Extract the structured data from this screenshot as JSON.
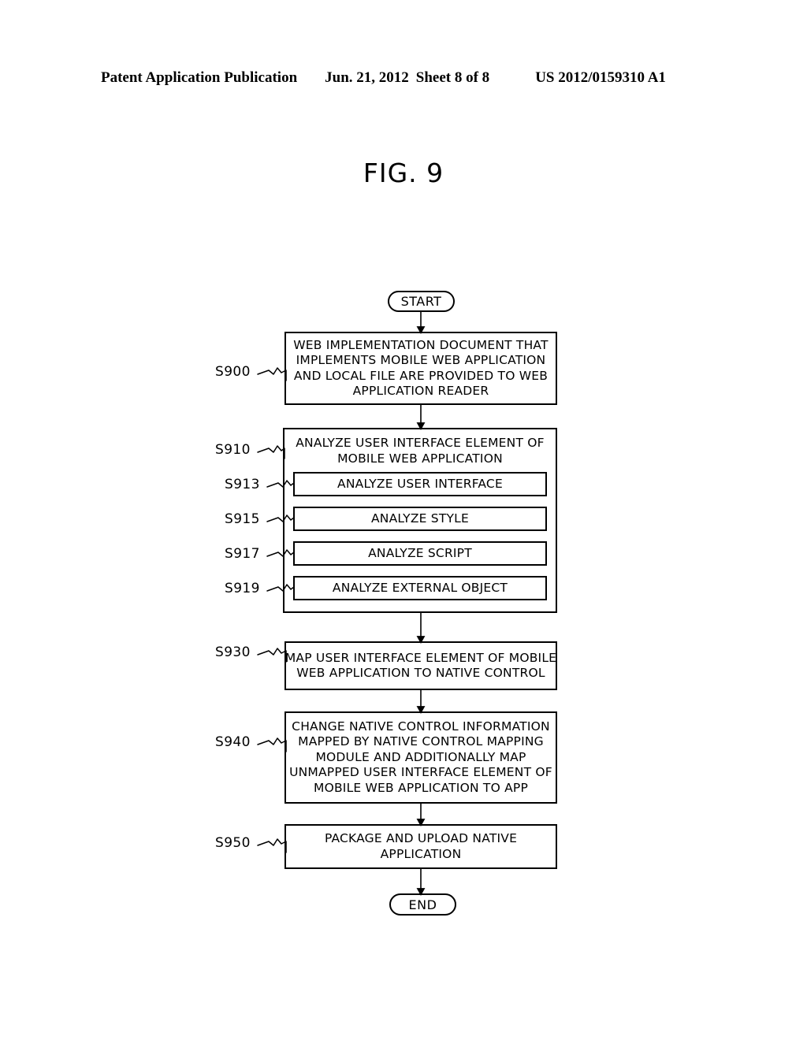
{
  "header": {
    "publication": "Patent Application Publication",
    "date": "Jun. 21, 2012",
    "sheet": "Sheet 8 of 8",
    "patent_number": "US 2012/0159310 A1"
  },
  "figure": {
    "title": "FIG. 9"
  },
  "flowchart": {
    "start_label": "START",
    "end_label": "END",
    "steps": {
      "s900": {
        "ref": "S900",
        "lines": [
          "WEB IMPLEMENTATION DOCUMENT THAT",
          "IMPLEMENTS MOBILE WEB APPLICATION",
          "AND LOCAL FILE ARE PROVIDED TO WEB",
          "APPLICATION READER"
        ]
      },
      "s910": {
        "ref": "S910",
        "lines": [
          "ANALYZE USER INTERFACE ELEMENT OF",
          "MOBILE WEB APPLICATION"
        ]
      },
      "s913": {
        "ref": "S913",
        "label": "ANALYZE USER INTERFACE"
      },
      "s915": {
        "ref": "S915",
        "label": "ANALYZE STYLE"
      },
      "s917": {
        "ref": "S917",
        "label": "ANALYZE SCRIPT"
      },
      "s919": {
        "ref": "S919",
        "label": "ANALYZE EXTERNAL OBJECT"
      },
      "s930": {
        "ref": "S930",
        "lines": [
          "MAP USER INTERFACE ELEMENT OF MOBILE",
          "WEB APPLICATION TO NATIVE CONTROL"
        ]
      },
      "s940": {
        "ref": "S940",
        "lines": [
          "CHANGE NATIVE CONTROL INFORMATION",
          "MAPPED BY NATIVE CONTROL MAPPING",
          "MODULE AND ADDITIONALLY MAP",
          "UNMAPPED USER INTERFACE ELEMENT OF",
          "MOBILE WEB APPLICATION TO APP"
        ]
      },
      "s950": {
        "ref": "S950",
        "lines": [
          "PACKAGE AND UPLOAD NATIVE",
          "APPLICATION"
        ]
      }
    }
  },
  "colors": {
    "ink": "#000000",
    "paper": "#ffffff"
  }
}
